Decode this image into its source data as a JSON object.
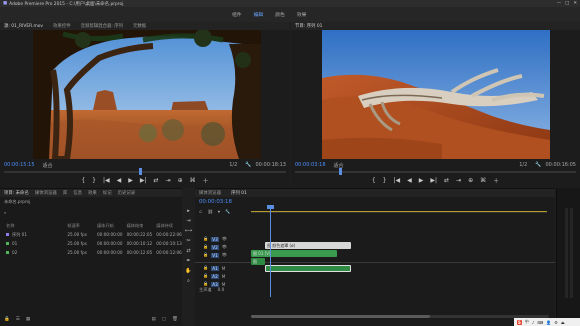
{
  "window": {
    "title": "Adobe Premiere Pro 2015 - C:\\用户\\桌面\\未命名.prproj"
  },
  "workspace_tabs": [
    {
      "label": "组件",
      "active": false
    },
    {
      "label": "编辑",
      "active": true
    },
    {
      "label": "颜色",
      "active": false
    },
    {
      "label": "效果",
      "active": false
    }
  ],
  "source_monitor": {
    "tabs": [
      "源: 01_RIVER.mov",
      "效果控件",
      "音频剪辑混合器: 序列",
      "元数据"
    ],
    "timecode_in": "00:00:15:15",
    "fit": "适合",
    "ratio": "1/2",
    "timecode_out": "00:00:18:13"
  },
  "program_monitor": {
    "tabs": [
      "节目: 序列 01"
    ],
    "timecode_in": "00:00:03:18",
    "fit": "适合",
    "ratio": "1/2",
    "timecode_out": "00:00:16:05"
  },
  "transport": [
    "⏵",
    "{",
    "}",
    "|◀",
    "◀",
    "▶",
    "▶|",
    "⇄",
    "⇥",
    "⊕",
    "⌘",
    "＋"
  ],
  "project_panel": {
    "tabs": [
      "项目: 未命名",
      "媒体浏览器",
      "库",
      "信息",
      "效果",
      "标记",
      "历史记录"
    ],
    "path": "未命名.prproj",
    "columns": [
      "名称",
      "帧速率",
      "媒体开始",
      "媒体结束",
      "媒体持续"
    ],
    "items": [
      {
        "color": "#8a7ee8",
        "name": "序列 01",
        "fps": "25.00 fps",
        "start": "00:00:00:00",
        "end": "00:00:22:05",
        "dur": "00:00:22:06"
      },
      {
        "color": "#4fb65c",
        "name": "01",
        "fps": "25.00 fps",
        "start": "00:00:00:00",
        "end": "00:00:10:12",
        "dur": "00:00:10:13"
      },
      {
        "color": "#4fb65c",
        "name": "02",
        "fps": "25.00 fps",
        "start": "00:00:00:00",
        "end": "00:00:12:05",
        "dur": "00:00:12:06"
      }
    ]
  },
  "timeline": {
    "tabs": [
      "媒体浏览器",
      "序列 01"
    ],
    "timecode": "00:00:03:18",
    "tracks": [
      {
        "id": "V3",
        "kind": "video"
      },
      {
        "id": "V2",
        "kind": "video"
      },
      {
        "id": "V1",
        "kind": "video"
      },
      {
        "id": "A1",
        "kind": "audio"
      },
      {
        "id": "A2",
        "kind": "audio"
      },
      {
        "id": "A3",
        "kind": "audio"
      }
    ],
    "master": "主声道",
    "master_value": "0.0",
    "clips": [
      {
        "label": "图 颜色遮罩 (ø)",
        "track": "V3",
        "color": "#d8d8d8"
      },
      {
        "label": "图 01 [V]",
        "track": "V2",
        "color": "#3a9a4e"
      },
      {
        "label": "图",
        "track": "V1",
        "color": "#2f8a43"
      }
    ]
  },
  "taskbar": {
    "items": [
      "S",
      "中",
      "♪",
      "⌨",
      "👤",
      "⚙",
      "⏏"
    ]
  }
}
